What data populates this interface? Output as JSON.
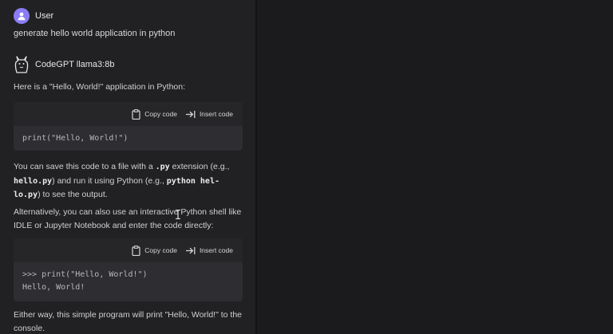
{
  "user": {
    "name": "User",
    "message": "generate hello world application in python"
  },
  "bot": {
    "name": "CodeGPT llama3:8b",
    "intro": "Here is a \"Hello, World!\" application in Python:",
    "code_blocks": [
      {
        "copy_label": "Copy code",
        "insert_label": "Insert code",
        "lines": [
          "print(\"Hello, World!\")"
        ]
      },
      {
        "copy_label": "Copy code",
        "insert_label": "Insert code",
        "lines": [
          ">>> print(\"Hello, World!\")",
          "Hello, World!"
        ]
      }
    ],
    "save_para": {
      "t1": "You can save this code to a file with a ",
      "c1": ".py",
      "t2": " extension (e.g.,",
      "c2": "hello.py",
      "t3": ") and run it using Python (e.g., ",
      "c3a": "python hel-",
      "c3b": "lo.py",
      "t4": ") to see the output."
    },
    "alt_para": "Alternatively, you can also use an interactive Python shell like IDLE or Jupyter Notebook and enter the code directly:",
    "closing_para": "Either way, this simple program will print \"Hello, World!\" to the console."
  },
  "icons": {
    "avatar": "person-icon",
    "bot_logo": "llama-icon",
    "copy": "clipboard-icon",
    "insert": "insert-arrow-icon"
  }
}
